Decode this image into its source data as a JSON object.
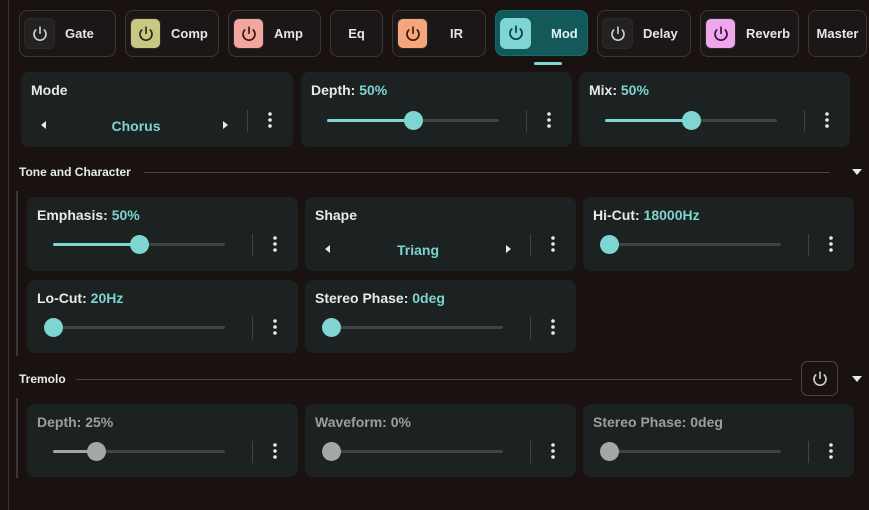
{
  "tabs": [
    {
      "id": "gate",
      "label": "Gate",
      "pw_bg": "#232221",
      "pw_stroke": "#c9cfce"
    },
    {
      "id": "comp",
      "label": "Comp",
      "pw_bg": "#c7c883",
      "pw_stroke": "#2c2a10"
    },
    {
      "id": "amp",
      "label": "Amp",
      "pw_bg": "#f2a6a0",
      "pw_stroke": "#3b1412"
    },
    {
      "id": "eq",
      "label": "Eq",
      "pw_bg": "",
      "pw_stroke": ""
    },
    {
      "id": "ir",
      "label": "IR",
      "pw_bg": "#f6a67d",
      "pw_stroke": "#3a170a"
    },
    {
      "id": "mod",
      "label": "Mod",
      "pw_bg": "#7ed5d1",
      "pw_stroke": "#0c3a39",
      "active": true
    },
    {
      "id": "delay",
      "label": "Delay",
      "pw_bg": "#232221",
      "pw_stroke": "#c9cfce"
    },
    {
      "id": "reverb",
      "label": "Reverb",
      "pw_bg": "#eea6ec",
      "pw_stroke": "#3a0f39"
    },
    {
      "id": "master",
      "label": "Master",
      "pw_bg": "",
      "pw_stroke": ""
    }
  ],
  "top": {
    "mode": {
      "label": "Mode",
      "value": "Chorus"
    },
    "depth": {
      "label": "Depth:",
      "value": "50%",
      "level": 0.5
    },
    "mix": {
      "label": "Mix:",
      "value": "50%",
      "level": 0.5
    }
  },
  "tone": {
    "title": "Tone and Character",
    "emphasis": {
      "label": "Emphasis:",
      "value": "50%",
      "level": 0.5
    },
    "shape": {
      "label": "Shape",
      "value": "Triang"
    },
    "hicut": {
      "label": "Hi-Cut:",
      "value": "18000Hz",
      "level": 0.0
    },
    "locut": {
      "label": "Lo-Cut:",
      "value": "20Hz",
      "level": 0.0
    },
    "stereo_phase": {
      "label": "Stereo Phase:",
      "value": "0deg",
      "level": 0.0
    }
  },
  "tremolo": {
    "title": "Tremolo",
    "depth": {
      "label": "Depth:",
      "value": "25%",
      "level": 0.25
    },
    "waveform": {
      "label": "Waveform:",
      "value": "0%",
      "level": 0.0
    },
    "stereo_phase": {
      "label": "Stereo Phase:",
      "value": "0deg",
      "level": 0.0
    }
  },
  "colors": {
    "accent": "#7ed5d1",
    "active_tab": "#13595a",
    "disabled": "#a6a6a6",
    "card": "#1c2221"
  },
  "icons": {
    "power": "power-icon",
    "kebab": "more-vert-icon",
    "left": "arrow-left-icon",
    "right": "arrow-right-icon",
    "caret": "caret-down-icon"
  }
}
